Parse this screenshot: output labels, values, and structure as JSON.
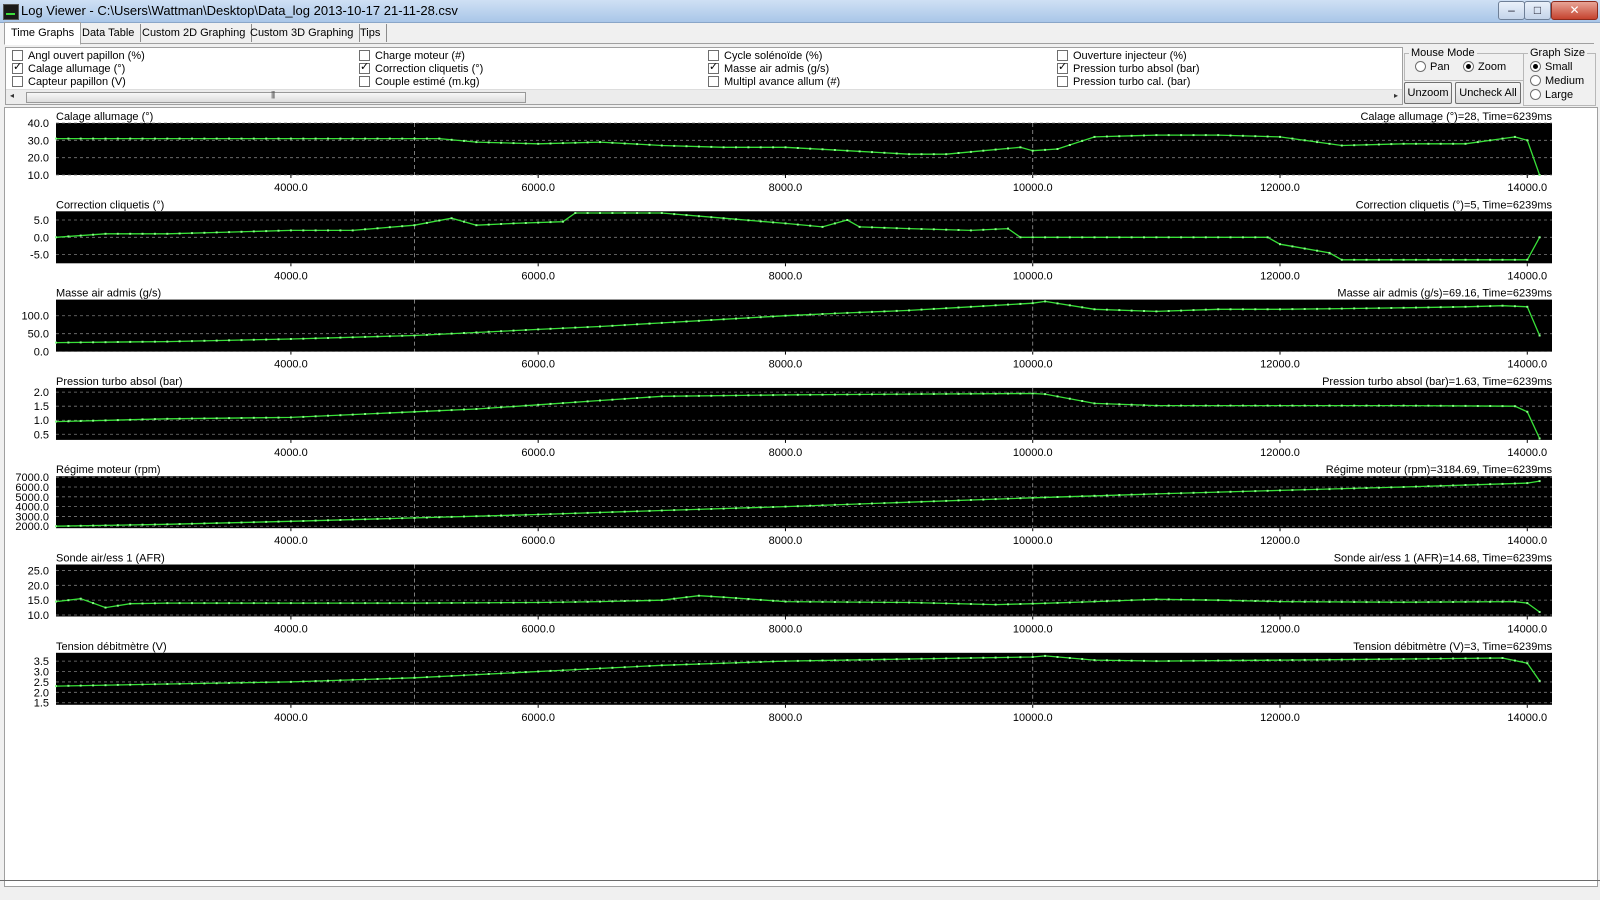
{
  "window": {
    "title": "Log Viewer - C:\\Users\\Wattman\\Desktop\\Data_log 2013-10-17 21-11-28.csv",
    "min_glyph": "–",
    "max_glyph": "□",
    "close_glyph": "✕"
  },
  "tabs": [
    {
      "label": "Time Graphs",
      "active": true
    },
    {
      "label": "Data Table",
      "active": false
    },
    {
      "label": "Custom 2D Graphing",
      "active": false
    },
    {
      "label": "Custom 3D Graphing",
      "active": false
    },
    {
      "label": "Tips",
      "active": false
    }
  ],
  "channels": [
    {
      "label": "Angl ouvert papillon (%)",
      "checked": false
    },
    {
      "label": "Calage allumage (°)",
      "checked": true
    },
    {
      "label": "Capteur papillon (V)",
      "checked": false
    },
    {
      "label": "Charge moteur (#)",
      "checked": false
    },
    {
      "label": "Correction cliquetis (°)",
      "checked": true
    },
    {
      "label": "Couple estimé (m.kg)",
      "checked": false
    },
    {
      "label": "Cycle solénoïde (%)",
      "checked": false
    },
    {
      "label": "Masse air admis (g/s)",
      "checked": true
    },
    {
      "label": "Multipl avance allum (#)",
      "checked": false
    },
    {
      "label": "Ouverture injecteur (%)",
      "checked": false
    },
    {
      "label": "Pression turbo absol (bar)",
      "checked": true
    },
    {
      "label": "Pression turbo cal. (bar)",
      "checked": false
    }
  ],
  "scrollbar": {
    "left_arrow": "◂",
    "right_arrow": "▸",
    "grip": "|||"
  },
  "mouse_mode": {
    "title": "Mouse Mode",
    "options": [
      {
        "label": "Pan",
        "selected": false
      },
      {
        "label": "Zoom",
        "selected": true
      }
    ]
  },
  "graph_size": {
    "title": "Graph Size",
    "options": [
      {
        "label": "Small",
        "selected": true
      },
      {
        "label": "Medium",
        "selected": false
      },
      {
        "label": "Large",
        "selected": false
      }
    ]
  },
  "buttons": {
    "unzoom": "Unzoom",
    "uncheck_all": "Uncheck All"
  },
  "colors": {
    "plot_bg": "#000000",
    "trace": "#38e038",
    "point": "#86ff86",
    "grid": "#7a7a7a",
    "cursor": "#ff3030"
  },
  "chart_data": [
    {
      "type": "line",
      "title": "Calage allumage (°)",
      "readout": "Calage allumage (°)=28, Time=6239ms",
      "xlim": [
        2100,
        14200
      ],
      "ylim": [
        10,
        40
      ],
      "yticks": [
        10,
        20,
        30,
        40
      ],
      "ytick_labels": [
        "10.0",
        "20.0",
        "30.0",
        "40.0"
      ],
      "xticks": [
        4000,
        6000,
        8000,
        10000,
        12000,
        14000
      ],
      "xtick_labels": [
        "4000.0",
        "6000.0",
        "8000.0",
        "10000.0",
        "12000.0",
        "14000.0"
      ],
      "x": [
        2100,
        2500,
        3000,
        3500,
        4000,
        4500,
        5000,
        5200,
        5500,
        6000,
        6500,
        7000,
        7500,
        8000,
        8500,
        9000,
        9300,
        9600,
        9900,
        10000,
        10200,
        10500,
        11000,
        11500,
        12000,
        12500,
        13000,
        13500,
        13900,
        14000,
        14100
      ],
      "y": [
        31,
        31,
        31,
        31,
        31,
        31,
        31,
        31,
        29,
        28,
        29,
        27,
        26,
        26,
        24,
        22,
        22,
        24,
        26,
        24,
        25,
        32,
        33,
        33,
        32,
        27,
        28,
        28,
        32,
        30,
        10
      ]
    },
    {
      "type": "line",
      "title": "Correction cliquetis (°)",
      "readout": "Correction cliquetis (°)=5, Time=6239ms",
      "xlim": [
        2100,
        14200
      ],
      "ylim": [
        -7.5,
        7.5
      ],
      "yticks": [
        -5,
        0,
        5
      ],
      "ytick_labels": [
        "-5.0",
        "0.0",
        "5.0"
      ],
      "xticks": [
        4000,
        6000,
        8000,
        10000,
        12000,
        14000
      ],
      "xtick_labels": [
        "4000.0",
        "6000.0",
        "8000.0",
        "10000.0",
        "12000.0",
        "14000.0"
      ],
      "x": [
        2100,
        2500,
        3000,
        3500,
        4000,
        4500,
        5000,
        5300,
        5500,
        5800,
        6200,
        6300,
        6500,
        7000,
        7500,
        8000,
        8300,
        8500,
        8600,
        9000,
        9500,
        9800,
        9900,
        10000,
        10500,
        10600,
        11000,
        11500,
        11900,
        12000,
        12400,
        12500,
        13000,
        13500,
        13900,
        14000,
        14100
      ],
      "y": [
        0,
        1,
        1,
        1.5,
        2,
        2,
        3.5,
        5.5,
        3.5,
        4,
        4.5,
        7,
        7,
        7,
        5.5,
        4,
        3,
        5,
        3,
        2.5,
        2,
        2.5,
        0,
        0,
        0,
        0,
        0,
        0,
        0,
        -2,
        -4.5,
        -6.5,
        -6.5,
        -6.5,
        -6.5,
        -6.5,
        0
      ]
    },
    {
      "type": "line",
      "title": "Masse air admis (g/s)",
      "readout": "Masse air admis (g/s)=69.16, Time=6239ms",
      "xlim": [
        2100,
        14200
      ],
      "ylim": [
        0,
        145
      ],
      "yticks": [
        0,
        50,
        100
      ],
      "ytick_labels": [
        "0.0",
        "50.0",
        "100.0"
      ],
      "xticks": [
        4000,
        6000,
        8000,
        10000,
        12000,
        14000
      ],
      "xtick_labels": [
        "4000.0",
        "6000.0",
        "8000.0",
        "10000.0",
        "12000.0",
        "14000.0"
      ],
      "x": [
        2100,
        3000,
        4000,
        5000,
        6000,
        6500,
        7000,
        7500,
        8000,
        8500,
        9000,
        9500,
        10000,
        10100,
        10500,
        11000,
        11500,
        12000,
        12500,
        13000,
        13500,
        13800,
        14000,
        14100
      ],
      "y": [
        25,
        28,
        35,
        45,
        62,
        70,
        80,
        90,
        100,
        108,
        115,
        125,
        135,
        140,
        118,
        112,
        118,
        118,
        120,
        122,
        125,
        128,
        125,
        45
      ]
    },
    {
      "type": "line",
      "title": "Pression turbo absol (bar)",
      "readout": "Pression turbo absol (bar)=1.63, Time=6239ms",
      "xlim": [
        2100,
        14200
      ],
      "ylim": [
        0.3,
        2.15
      ],
      "yticks": [
        0.5,
        1.0,
        1.5,
        2.0
      ],
      "ytick_labels": [
        "0.5",
        "1.0",
        "1.5",
        "2.0"
      ],
      "xticks": [
        4000,
        6000,
        8000,
        10000,
        12000,
        14000
      ],
      "xtick_labels": [
        "4000.0",
        "6000.0",
        "8000.0",
        "10000.0",
        "12000.0",
        "14000.0"
      ],
      "x": [
        2100,
        3000,
        4000,
        5000,
        5500,
        6000,
        6500,
        7000,
        8000,
        9000,
        10000,
        10100,
        10500,
        11000,
        12000,
        13000,
        13900,
        14000,
        14100
      ],
      "y": [
        0.95,
        1.05,
        1.1,
        1.3,
        1.4,
        1.55,
        1.7,
        1.85,
        1.9,
        1.93,
        1.95,
        1.93,
        1.6,
        1.52,
        1.52,
        1.52,
        1.5,
        1.3,
        0.35
      ]
    },
    {
      "type": "line",
      "title": "Régime moteur (rpm)",
      "readout": "Régime moteur (rpm)=3184.69, Time=6239ms",
      "xlim": [
        2100,
        14200
      ],
      "ylim": [
        1800,
        7100
      ],
      "yticks": [
        2000,
        3000,
        4000,
        5000,
        6000,
        7000
      ],
      "ytick_labels": [
        "2000.0",
        "3000.0",
        "4000.0",
        "5000.0",
        "6000.0",
        "7000.0"
      ],
      "xticks": [
        4000,
        6000,
        8000,
        10000,
        12000,
        14000
      ],
      "xtick_labels": [
        "4000.0",
        "6000.0",
        "8000.0",
        "10000.0",
        "12000.0",
        "14000.0"
      ],
      "x": [
        2100,
        3000,
        4000,
        5000,
        6000,
        7000,
        8000,
        9000,
        10000,
        11000,
        12000,
        13000,
        14000,
        14100
      ],
      "y": [
        2000,
        2200,
        2500,
        2850,
        3200,
        3600,
        4000,
        4450,
        4900,
        5300,
        5650,
        6000,
        6400,
        6600
      ]
    },
    {
      "type": "line",
      "title": "Sonde air/ess 1 (AFR)",
      "readout": "Sonde air/ess 1 (AFR)=14.68, Time=6239ms",
      "xlim": [
        2100,
        14200
      ],
      "ylim": [
        9.5,
        27
      ],
      "yticks": [
        10,
        15,
        20,
        25
      ],
      "ytick_labels": [
        "10.0",
        "15.0",
        "20.0",
        "25.0"
      ],
      "xticks": [
        4000,
        6000,
        8000,
        10000,
        12000,
        14000
      ],
      "xtick_labels": [
        "4000.0",
        "6000.0",
        "8000.0",
        "10000.0",
        "12000.0",
        "14000.0"
      ],
      "x": [
        2100,
        2300,
        2500,
        2700,
        3000,
        4000,
        5000,
        6000,
        6500,
        7000,
        7300,
        7500,
        8000,
        9000,
        9700,
        10000,
        10500,
        11000,
        11500,
        12000,
        13000,
        13900,
        14000,
        14100
      ],
      "y": [
        14.5,
        15.5,
        12.5,
        13.8,
        14,
        14,
        14,
        14.2,
        14.5,
        15,
        16.5,
        16,
        14.5,
        14.2,
        13.5,
        13.8,
        14.5,
        15.3,
        15,
        14.5,
        14.3,
        14.5,
        14,
        11
      ]
    },
    {
      "type": "line",
      "title": "Tension débitmètre (V)",
      "readout": "Tension débitmètre (V)=3, Time=6239ms",
      "xlim": [
        2100,
        14200
      ],
      "ylim": [
        1.4,
        3.9
      ],
      "yticks": [
        1.5,
        2.0,
        2.5,
        3.0,
        3.5
      ],
      "ytick_labels": [
        "1.5",
        "2.0",
        "2.5",
        "3.0",
        "3.5"
      ],
      "xticks": [
        4000,
        6000,
        8000,
        10000,
        12000,
        14000
      ],
      "xtick_labels": [
        "4000.0",
        "6000.0",
        "8000.0",
        "10000.0",
        "12000.0",
        "14000.0"
      ],
      "x": [
        2100,
        3000,
        4000,
        5000,
        6000,
        7000,
        8000,
        9000,
        10000,
        10100,
        10500,
        11000,
        12000,
        13000,
        13800,
        14000,
        14100
      ],
      "y": [
        2.3,
        2.4,
        2.5,
        2.7,
        3.0,
        3.3,
        3.5,
        3.6,
        3.7,
        3.75,
        3.55,
        3.5,
        3.55,
        3.6,
        3.65,
        3.4,
        2.55
      ]
    }
  ]
}
